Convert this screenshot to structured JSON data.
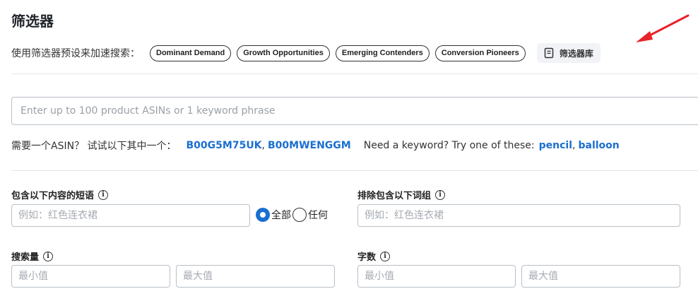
{
  "page": {
    "title": "筛选器"
  },
  "presets": {
    "label": "使用筛选器预设来加速搜索：",
    "chips": [
      "Dominant Demand",
      "Growth Opportunities",
      "Emerging Contenders",
      "Conversion Pioneers"
    ],
    "library_button": "筛选器库"
  },
  "search": {
    "placeholder": "Enter up to 100 product ASINs or 1 keyword phrase"
  },
  "hints": {
    "asin_prompt": "需要一个ASIN？ 试试以下其中一个：",
    "asin_1": "B00G5M75UK",
    "asin_sep": ",",
    "asin_2": "B00MWENGGM",
    "keyword_prompt": "Need a keyword? Try one of these:",
    "kw_1": "pencil",
    "kw_sep": ",",
    "kw_2": "balloon"
  },
  "filters": {
    "include_phrase": {
      "label": "包含以下内容的短语",
      "placeholder": "例如：红色连衣裙"
    },
    "match_all": "全部",
    "match_any": "任何",
    "exclude_phrase": {
      "label": "排除包含以下词组",
      "placeholder": "例如：红色连衣裙"
    },
    "search_volume": {
      "label": "搜索量",
      "min_placeholder": "最小值",
      "max_placeholder": "最大值"
    },
    "word_count": {
      "label": "字数",
      "min_placeholder": "最小值",
      "max_placeholder": "最大值"
    },
    "info_glyph": "i"
  },
  "colors": {
    "accent": "#1a6fd1",
    "arrow": "#e8232a",
    "border": "#b9c0c8"
  }
}
